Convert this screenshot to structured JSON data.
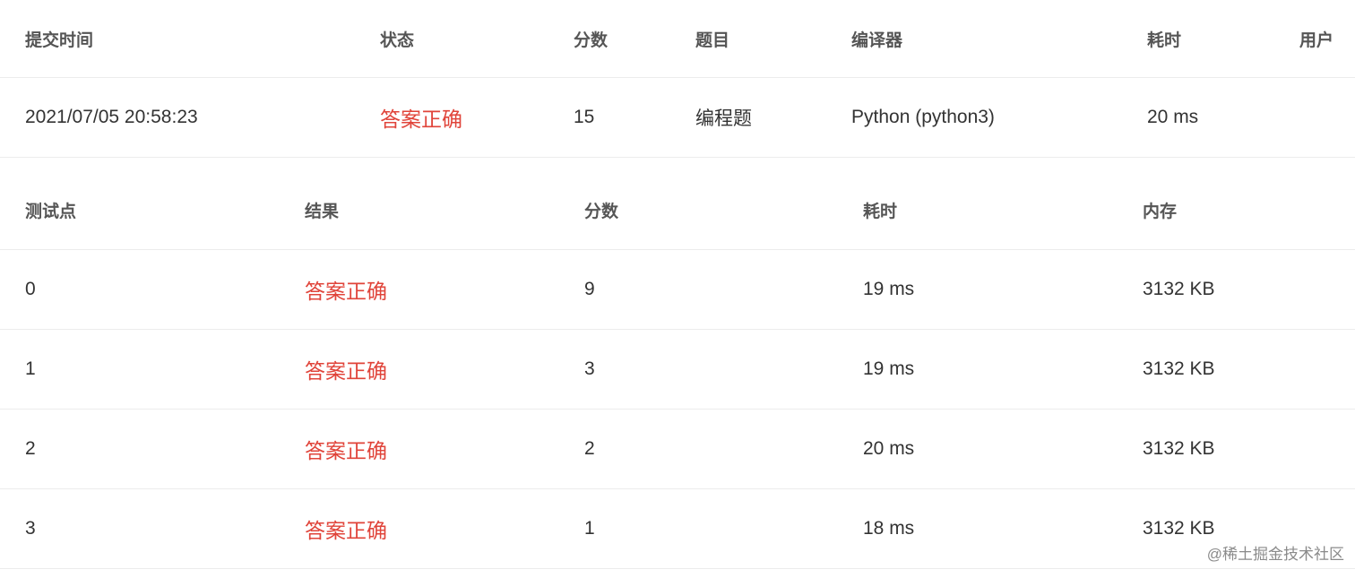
{
  "submission": {
    "headers": {
      "time": "提交时间",
      "status": "状态",
      "score": "分数",
      "problem": "题目",
      "compiler": "编译器",
      "elapsed": "耗时",
      "user": "用户"
    },
    "row": {
      "time": "2021/07/05 20:58:23",
      "status": "答案正确",
      "score": "15",
      "problem": "编程题",
      "compiler": "Python (python3)",
      "elapsed": "20 ms",
      "user": ""
    }
  },
  "testcases": {
    "headers": {
      "case": "测试点",
      "result": "结果",
      "score": "分数",
      "elapsed": "耗时",
      "memory": "内存"
    },
    "rows": [
      {
        "case": "0",
        "result": "答案正确",
        "score": "9",
        "elapsed": "19 ms",
        "memory": "3132 KB"
      },
      {
        "case": "1",
        "result": "答案正确",
        "score": "3",
        "elapsed": "19 ms",
        "memory": "3132 KB"
      },
      {
        "case": "2",
        "result": "答案正确",
        "score": "2",
        "elapsed": "20 ms",
        "memory": "3132 KB"
      },
      {
        "case": "3",
        "result": "答案正确",
        "score": "1",
        "elapsed": "18 ms",
        "memory": "3132 KB"
      }
    ]
  },
  "watermark": "@稀土掘金技术社区",
  "colors": {
    "accepted": "#e0443a",
    "border": "#ececec",
    "header_text": "#555555"
  }
}
